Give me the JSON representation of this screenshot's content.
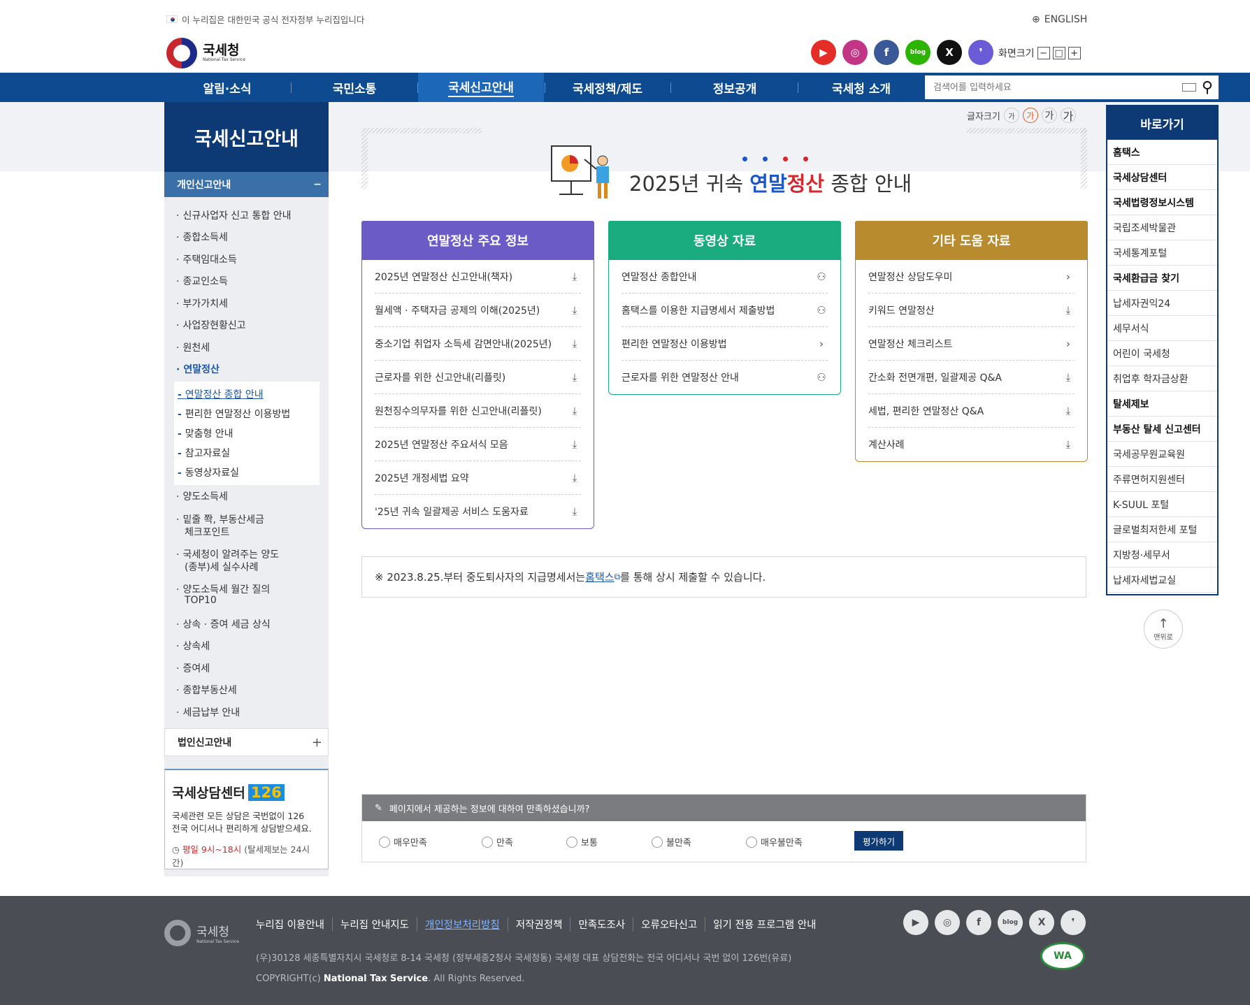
{
  "top": {
    "notice": "이 누리집은 대한민국 공식 전자정부 누리집입니다",
    "english": "ENGLISH",
    "logo_name": "국세청",
    "logo_sub": "National Tax Service",
    "font_size_label": "화면크기",
    "sns": [
      "youtube-icon",
      "instagram-icon",
      "facebook-icon",
      "blog-icon",
      "x-icon",
      "kakao-icon"
    ]
  },
  "gnb": {
    "items": [
      "알림·소식",
      "국민소통",
      "국세신고안내",
      "국세정책/제도",
      "정보공개",
      "국세청 소개"
    ],
    "active_index": 2,
    "search_placeholder": "검색어를 입력하세요"
  },
  "lnb": {
    "title": "국세신고안내",
    "section": "개인신고안내",
    "items": [
      "신규사업자 신고 통합 안내",
      "종합소득세",
      "주택임대소득",
      "종교인소득",
      "부가가치세",
      "사업장현황신고",
      "원천세",
      "연말정산"
    ],
    "sub_items": [
      "연말정산 종합 안내",
      "편리한 연말정산 이용방법",
      "맞춤형 안내",
      "참고자료실",
      "동영상자료실"
    ],
    "items_after": [
      "양도소득세",
      "밑줄 쫙, 부동산세금",
      "체크포인트",
      "국세청이 알려주는 양도",
      "(종부)세 실수사례",
      "양도소득세 월간 질의",
      "TOP10",
      "상속 · 증여 세금 상식",
      "상속세",
      "증여세",
      "종합부동산세",
      "세금납부 안내"
    ],
    "corp_section": "법인신고안내"
  },
  "consult": {
    "title": "국세상담센터",
    "number": "126",
    "desc1": "국세관련 모든 상담은 국번없이 126",
    "desc2": "전국 어디서나 편리하게 상담받으세요.",
    "time_highlight": "평일 9시~18시",
    "time_rest": "(탈세제보는 24시간)"
  },
  "content": {
    "font_label": "글자크기",
    "font_buttons": [
      "가",
      "가",
      "가",
      "가"
    ],
    "title_pre": "2025년 귀속 ",
    "title_blue": "연말",
    "title_red": "정산",
    "title_post": " 종합 안내",
    "colors": {
      "purple": "#6b5bc6",
      "green": "#1aab7e",
      "gold": "#b78b2e",
      "blue": "#1a57c8",
      "red": "#d9262c"
    },
    "cards": [
      {
        "title": "연말정산 주요 정보",
        "rows": [
          {
            "label": "2025년 연말정산 신고안내(책자)",
            "icon": "download-icon"
          },
          {
            "label": "월세액 · 주택자금 공제의 이해(2025년)",
            "icon": "download-icon"
          },
          {
            "label": "중소기업 취업자 소득세 감면안내(2025년)",
            "icon": "download-icon"
          },
          {
            "label": "근로자를 위한 신고안내(리플릿)",
            "icon": "download-icon"
          },
          {
            "label": "원천징수의무자를 위한 신고안내(리플릿)",
            "icon": "download-icon"
          },
          {
            "label": "2025년 연말정산 주요서식 모음",
            "icon": "download-icon"
          },
          {
            "label": "2025년 개정세법 요약",
            "icon": "download-icon"
          },
          {
            "label": "'25년 귀속 일괄제공 서비스 도움자료",
            "icon": "download-icon"
          }
        ]
      },
      {
        "title": "동영상 자료",
        "rows": [
          {
            "label": "연말정산 종합안내",
            "icon": "video-icon"
          },
          {
            "label": "홈택스를 이용한 지급명세서 제출방법",
            "icon": "video-icon"
          },
          {
            "label": "편리한 연말정산 이용방법",
            "icon": "chevron-right-icon"
          },
          {
            "label": "근로자를 위한 연말정산 안내",
            "icon": "video-icon"
          }
        ]
      },
      {
        "title": "기타 도움 자료",
        "rows": [
          {
            "label": "연말정산 상담도우미",
            "icon": "chevron-right-icon"
          },
          {
            "label": "키워드 연말정산",
            "icon": "download-icon"
          },
          {
            "label": "연말정산 체크리스트",
            "icon": "chevron-right-icon"
          },
          {
            "label": "간소화 전면개편, 일괄제공 Q&A",
            "icon": "download-icon"
          },
          {
            "label": "세법, 편리한 연말정산 Q&A",
            "icon": "download-icon"
          },
          {
            "label": "계산사례",
            "icon": "download-icon"
          }
        ]
      }
    ],
    "notice_pre": "※ 2023.8.25.부터 중도퇴사자의 지급명세서는 ",
    "notice_link": "홈택스",
    "notice_post": "를 통해 상시 제출할 수 있습니다."
  },
  "survey": {
    "question": "페이지에서 제공하는 정보에 대하여 만족하셨습니까?",
    "options": [
      "매우만족",
      "만족",
      "보통",
      "불만족",
      "매우불만족"
    ],
    "button": "평가하기"
  },
  "quick": {
    "title": "바로가기",
    "items": [
      "홈택스",
      "국세상담센터",
      "국세법령정보시스템",
      "국립조세박물관",
      "국세통계포털",
      "국세환급금 찾기",
      "납세자권익24",
      "세무서식",
      "어린이 국세청",
      "취업후 학자금상환",
      "탈세제보",
      "부동산 탈세 신고센터",
      "국세공무원교육원",
      "주류면허지원센터",
      "K-SUUL 포털",
      "글로벌최저한세 포털",
      "지방청·세무서",
      "납세자세법교실"
    ],
    "bold": [
      0,
      1,
      2,
      5,
      10,
      11
    ],
    "top_label": "맨위로"
  },
  "footer": {
    "logo_name": "국세청",
    "logo_sub": "National Tax Service",
    "links": [
      "누리집 이용안내",
      "누리집 안내지도",
      "개인정보처리방침",
      "저작권정책",
      "만족도조사",
      "오류오타신고",
      "읽기 전용 프로그램 안내"
    ],
    "address": "(우)30128 세종특별자치시 국세청로 8-14 국세청 (정부세종2청사 국세청동) 국세청 대표 상담전화는 전국 어디서나 국번 없이 126번(유료)",
    "copy_pre": "COPYRIGHT(c) ",
    "copy_bold": "National Tax Service",
    "copy_post": ". All Rights Reserved.",
    "wa": "WA"
  }
}
